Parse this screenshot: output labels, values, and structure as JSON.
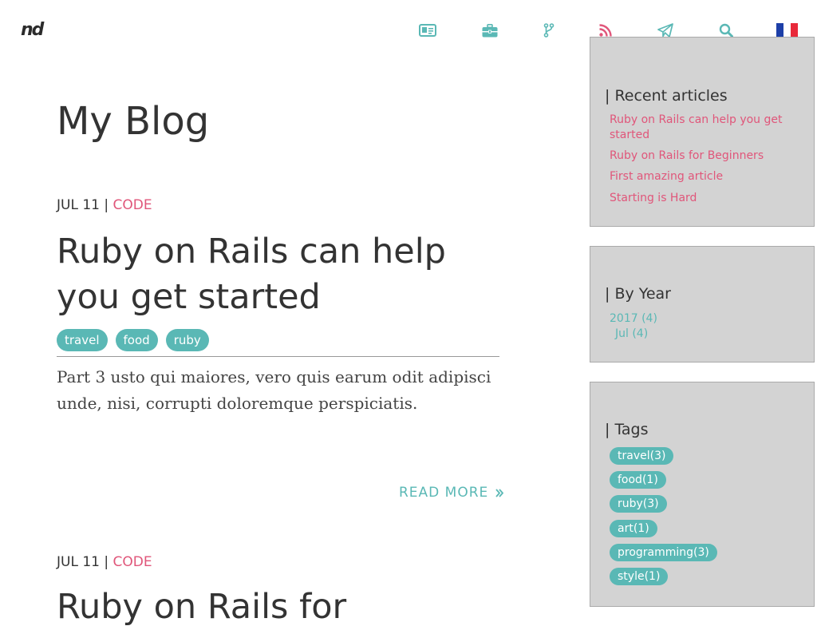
{
  "header": {
    "logo": "nd",
    "nav_icons": [
      "id-card-icon",
      "briefcase-icon",
      "code-fork-icon",
      "rss-icon",
      "paper-plane-icon",
      "search-icon"
    ],
    "language_flag": "france-flag-icon",
    "accent_color": "#5ab8b5"
  },
  "main": {
    "page_title": "My Blog",
    "posts": [
      {
        "date": "JUL 11",
        "separator": "|",
        "category": "CODE",
        "title": "Ruby on Rails can help you get started",
        "tags": [
          "travel",
          "food",
          "ruby"
        ],
        "excerpt": "Part 3 usto qui maiores, vero quis earum odit adipisci unde, nisi, corrupti doloremque perspiciatis.",
        "read_more": "READ MORE"
      },
      {
        "date": "JUL 11",
        "separator": "|",
        "category": "CODE",
        "title": "Ruby on Rails for"
      }
    ]
  },
  "sidebar": {
    "recent": {
      "title": "| Recent articles",
      "items": [
        "Ruby on Rails can help you get started",
        "Ruby on Rails for Beginners",
        "First amazing article",
        "Starting is Hard"
      ]
    },
    "by_year": {
      "title": "| By Year",
      "year": "2017 (4)",
      "month": "Jul (4)"
    },
    "tags": {
      "title": "| Tags",
      "items": [
        "travel(3)",
        "food(1)",
        "ruby(3)",
        "art(1)",
        "programming(3)",
        "style(1)"
      ]
    }
  },
  "colors": {
    "teal": "#5ab8b5",
    "pink": "#e0567a",
    "panel_bg": "#d3d3d3"
  }
}
